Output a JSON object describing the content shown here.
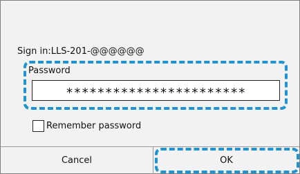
{
  "dialog": {
    "sign_in_text": "Sign in:LLS-201-@@@@@@",
    "password_label": "Password",
    "password_value": "***********************",
    "remember_label": "Remember password",
    "remember_checked": false
  },
  "buttons": {
    "cancel_label": "Cancel",
    "ok_label": "OK"
  },
  "colors": {
    "highlight": "#1e93d1",
    "dialog_background": "#f2f2f2"
  }
}
